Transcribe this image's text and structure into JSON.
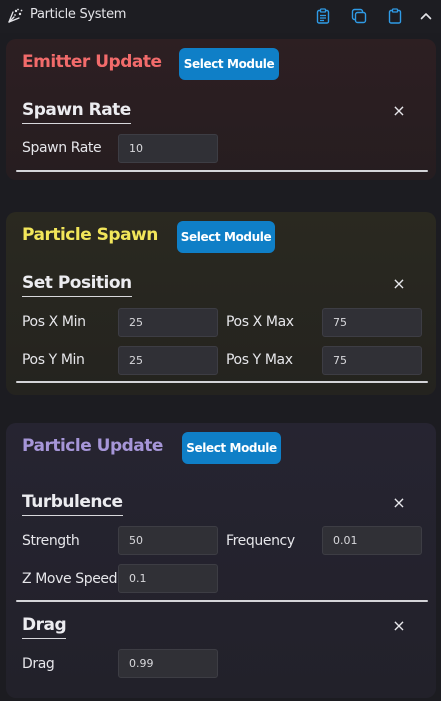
{
  "window": {
    "title": "Particle System",
    "icons": [
      "particles-icon",
      "clipboard-list-icon",
      "copy-icon",
      "paste-icon",
      "chevron-up-icon"
    ]
  },
  "colors": {
    "emitter_title": "#f26b6b",
    "spawn_title": "#f2e65a",
    "update_title": "#a696d8",
    "button": "#0f7fc7"
  },
  "sections": {
    "emitter_update": {
      "title": "Emitter Update",
      "select_label": "Select Module",
      "modules": {
        "spawn_rate": {
          "title": "Spawn Rate",
          "close": "×",
          "fields": {
            "spawn_rate": {
              "label": "Spawn Rate",
              "value": "10"
            }
          }
        }
      }
    },
    "particle_spawn": {
      "title": "Particle Spawn",
      "select_label": "Select Module",
      "modules": {
        "set_position": {
          "title": "Set Position",
          "close": "×",
          "fields": {
            "pos_x_min": {
              "label": "Pos X Min",
              "value": "25"
            },
            "pos_x_max": {
              "label": "Pos X Max",
              "value": "75"
            },
            "pos_y_min": {
              "label": "Pos Y Min",
              "value": "25"
            },
            "pos_y_max": {
              "label": "Pos Y Max",
              "value": "75"
            }
          }
        }
      }
    },
    "particle_update": {
      "title": "Particle Update",
      "select_label": "Select Module",
      "modules": {
        "turbulence": {
          "title": "Turbulence",
          "close": "×",
          "fields": {
            "strength": {
              "label": "Strength",
              "value": "50"
            },
            "frequency": {
              "label": "Frequency",
              "value": "0.01"
            },
            "z_move_speed": {
              "label": "Z Move Speed",
              "value": "0.1"
            }
          }
        },
        "drag": {
          "title": "Drag",
          "close": "×",
          "fields": {
            "drag": {
              "label": "Drag",
              "value": "0.99"
            }
          }
        }
      }
    }
  }
}
